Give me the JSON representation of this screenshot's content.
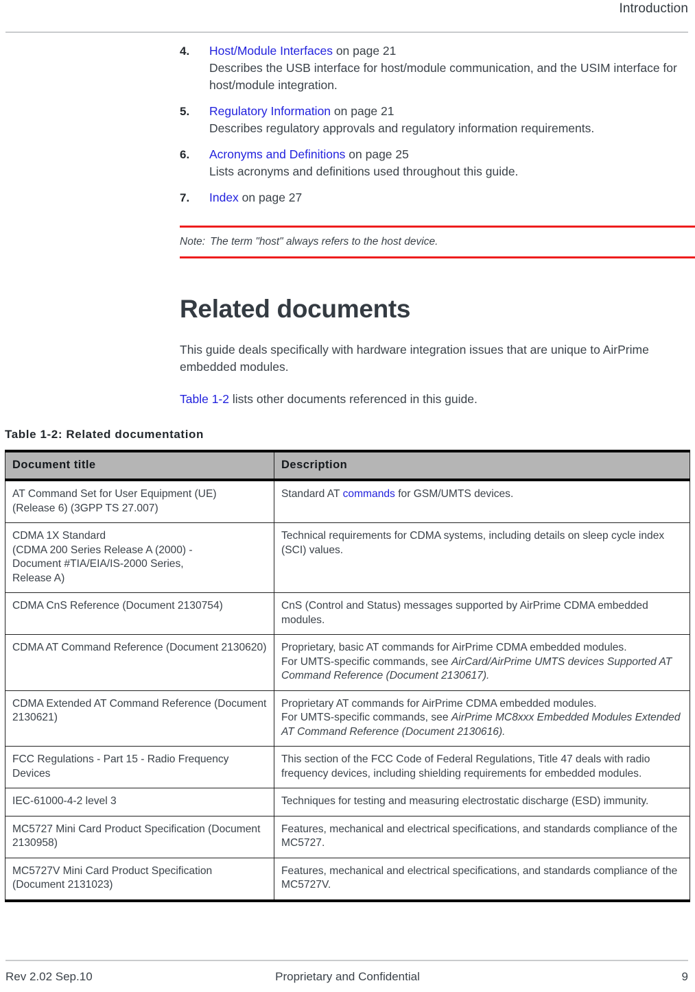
{
  "header": {
    "title": "Introduction"
  },
  "list": {
    "items": [
      {
        "marker": "4.",
        "link": "Host/Module Interfaces",
        "page_ref": " on page 21",
        "description": "Describes the USB interface for host/module communication, and the USIM interface for host/module integration."
      },
      {
        "marker": "5.",
        "link": "Regulatory Information",
        "page_ref": " on page 21",
        "description": "Describes regulatory approvals and regulatory information requirements."
      },
      {
        "marker": "6.",
        "link": "Acronyms and Definitions",
        "page_ref": " on page 25",
        "description": "Lists acronyms and definitions used throughout this guide."
      },
      {
        "marker": "7.",
        "link": "Index",
        "page_ref": " on page 27",
        "description": ""
      }
    ]
  },
  "note": {
    "label": "Note:",
    "text": "The term \"host\" always refers to the host device.",
    "rule_color": "#ee1d1d"
  },
  "section": {
    "heading": "Related documents",
    "paragraph_1": "This guide deals specifically with hardware integration issues that are unique to AirPrime embedded modules.",
    "paragraph_2_link": "Table 1-2",
    "paragraph_2_rest": " lists other documents referenced in this guide."
  },
  "table": {
    "caption": "Table 1-2:  Related documentation",
    "columns": [
      "Document title",
      "Description"
    ],
    "header_background": "#b5b5b5",
    "link_color": "#2222dd",
    "rows": [
      {
        "title_lines": [
          "AT Command Set for User Equipment (UE)",
          "(Release 6) (3GPP TS 27.007)"
        ],
        "description_parts": [
          {
            "text": "Standard AT ",
            "style": "normal"
          },
          {
            "text": "commands",
            "style": "link"
          },
          {
            "text": " for GSM/UMTS devices.",
            "style": "normal"
          }
        ]
      },
      {
        "title_lines": [
          "CDMA 1X Standard",
          "(CDMA 200 Series Release A (2000) -",
          "Document #TIA/EIA/IS-2000 Series,",
          "Release A)"
        ],
        "description_parts": [
          {
            "text": "Technical requirements for CDMA systems, including details on sleep cycle index (SCI) values.",
            "style": "normal"
          }
        ]
      },
      {
        "title_lines": [
          "CDMA CnS Reference (Document 2130754)"
        ],
        "description_parts": [
          {
            "text": "CnS (Control and Status) messages supported by AirPrime CDMA embedded modules.",
            "style": "normal"
          }
        ]
      },
      {
        "title_lines": [
          "CDMA AT Command Reference (Document 2130620)"
        ],
        "description_parts": [
          {
            "text": "Proprietary, basic AT commands for AirPrime CDMA embedded modules.",
            "style": "normal",
            "break_after": true
          },
          {
            "text": "For UMTS-specific commands, see ",
            "style": "normal"
          },
          {
            "text": "AirCard/AirPrime UMTS devices Supported AT Command Reference (Document 2130617).",
            "style": "italic"
          }
        ]
      },
      {
        "title_lines": [
          "CDMA Extended AT Command Reference (Document 2130621)"
        ],
        "description_parts": [
          {
            "text": "Proprietary AT commands for AirPrime CDMA embedded modules.",
            "style": "normal",
            "break_after": true
          },
          {
            "text": "For UMTS-specific commands, see ",
            "style": "normal"
          },
          {
            "text": "AirPrime MC8xxx Embedded Modules Extended AT Command Reference (Document 2130616).",
            "style": "italic"
          }
        ]
      },
      {
        "title_lines": [
          "FCC Regulations - Part 15 - Radio Frequency Devices"
        ],
        "description_parts": [
          {
            "text": "This section of the FCC Code of Federal Regulations, Title 47 deals with radio frequency devices, including shielding requirements for embedded modules.",
            "style": "normal"
          }
        ]
      },
      {
        "title_lines": [
          "IEC-61000-4-2 level 3"
        ],
        "description_parts": [
          {
            "text": "Techniques for testing and measuring electrostatic discharge (ESD) immunity.",
            "style": "normal"
          }
        ]
      },
      {
        "title_lines": [
          "MC5727 Mini Card Product Specification (Document 2130958)"
        ],
        "description_parts": [
          {
            "text": "Features, mechanical and electrical specifications, and standards compliance of the MC5727.",
            "style": "normal"
          }
        ]
      },
      {
        "title_lines": [
          "MC5727V Mini Card Product Specification (Document 2131023)"
        ],
        "description_parts": [
          {
            "text": "Features, mechanical and electrical specifications, and standards compliance of the MC5727V.",
            "style": "normal"
          }
        ]
      }
    ]
  },
  "footer": {
    "revision": "Rev 2.02  Sep.10",
    "confidentiality": "Proprietary and Confidential",
    "page_number": "9"
  }
}
